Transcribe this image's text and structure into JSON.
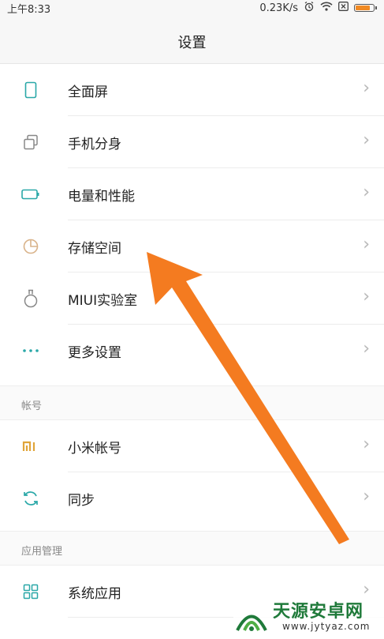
{
  "status_bar": {
    "time": "上午8:33",
    "speed": "0.23K/s",
    "battery_level": 0.85
  },
  "nav": {
    "title": "设置"
  },
  "group1": [
    {
      "label": "全面屏",
      "icon": "phone-outline-icon"
    },
    {
      "label": "手机分身",
      "icon": "dual-copy-icon"
    },
    {
      "label": "电量和性能",
      "icon": "battery-icon"
    },
    {
      "label": "存储空间",
      "icon": "pie-storage-icon"
    },
    {
      "label": "MIUI实验室",
      "icon": "lab-flask-icon"
    },
    {
      "label": "更多设置",
      "icon": "more-dots-icon"
    }
  ],
  "section_account": {
    "title": "帐号",
    "items": [
      {
        "label": "小米帐号",
        "icon": "mi-logo-icon"
      },
      {
        "label": "同步",
        "icon": "sync-icon"
      }
    ]
  },
  "section_apps": {
    "title": "应用管理",
    "items": [
      {
        "label": "系统应用",
        "icon": "grid-apps-icon"
      }
    ]
  },
  "colors": {
    "accent_teal": "#2aa8a8",
    "arrow_orange": "#f47b20",
    "watermark_green": "#1f7a3a"
  },
  "watermark": {
    "name": "天源安卓网",
    "url": "www.jytyaz.com"
  }
}
